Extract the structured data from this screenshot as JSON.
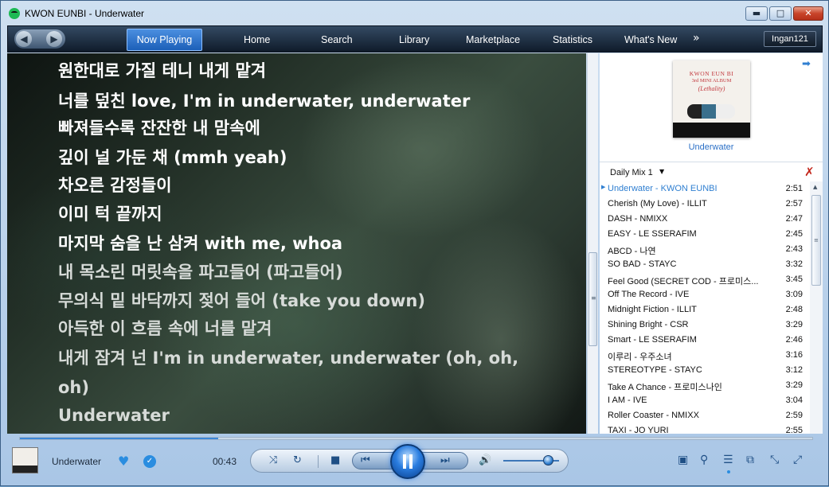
{
  "window": {
    "title": "KWON EUNBI - Underwater",
    "minimize_glyph": "▬",
    "maximize_glyph": "□",
    "close_glyph": "✕"
  },
  "nav": {
    "back_glyph": "◀",
    "forward_glyph": "▶",
    "tabs": [
      "Now Playing",
      "Home",
      "Search",
      "Library",
      "Marketplace",
      "Statistics",
      "What's New"
    ],
    "more_glyph": "»",
    "user": "Ingan121"
  },
  "lyrics": {
    "sung": [
      "원한대로 가질 테니 내게 맡겨",
      "너를 덮친 love, I'm in underwater, underwater",
      "빠져들수록 잔잔한 내 맘속에",
      "깊이 널 가둔 채 (mmh yeah)",
      "차오른 감정들이",
      "이미 턱 끝까지",
      "마지막 숨을 난 삼켜 with me, whoa"
    ],
    "upcoming": [
      "내 목소린 머릿속을 파고들어 (파고들어)",
      "무의식 밑 바닥까지 젖어 들어 (take you down)",
      "아득한 이 흐름 속에 너를 맡겨",
      "내게 잠겨 넌 I'm in underwater, underwater (oh, oh,",
      "oh)",
      "Underwater"
    ]
  },
  "now_playing": {
    "album_line1": "KWON EUN BI",
    "album_line2": "3rd MINI ALBUM",
    "album_line3": "(Lethality)",
    "title": "Underwater",
    "goto_glyph": "➡"
  },
  "playlist": {
    "name": "Daily Mix 1",
    "caret": "▼",
    "clear_glyph": "✗",
    "current_marker": "▶",
    "tracks": [
      {
        "title": "Underwater - KWON EUNBI",
        "duration": "2:51",
        "current": true
      },
      {
        "title": "Cherish (My Love) - ILLIT",
        "duration": "2:57"
      },
      {
        "title": "DASH - NMIXX",
        "duration": "2:47"
      },
      {
        "title": "EASY - LE SSERAFIM",
        "duration": "2:45"
      },
      {
        "title": "ABCD - 나연",
        "duration": "2:43"
      },
      {
        "title": "SO BAD - STAYC",
        "duration": "3:32"
      },
      {
        "title": "Feel Good (SECRET COD - 프로미스...",
        "duration": "3:45"
      },
      {
        "title": "Off The Record - IVE",
        "duration": "3:09"
      },
      {
        "title": "Midnight Fiction - ILLIT",
        "duration": "2:48"
      },
      {
        "title": "Shining Bright - CSR",
        "duration": "3:29"
      },
      {
        "title": "Smart - LE SSERAFIM",
        "duration": "2:46"
      },
      {
        "title": "이루리 - 우주소녀",
        "duration": "3:16"
      },
      {
        "title": "STEREOTYPE - STAYC",
        "duration": "3:12"
      },
      {
        "title": "Take A Chance - 프로미스나인",
        "duration": "3:29"
      },
      {
        "title": "I AM - IVE",
        "duration": "3:04"
      },
      {
        "title": "Roller Coaster - NMIXX",
        "duration": "2:59"
      },
      {
        "title": "TAXI - JO YURI",
        "duration": "2:55"
      }
    ]
  },
  "player": {
    "title": "Underwater",
    "elapsed": "00:43",
    "progress": 0.25,
    "volume": 0.8,
    "heart_glyph": "♥",
    "check_glyph": "✓",
    "shuffle_glyph": "⤨",
    "repeat_glyph": "↻",
    "stop_glyph": "■",
    "prev_glyph": "⏮",
    "next_glyph": "⏭",
    "volume_glyph": "🔊",
    "lyrics_glyph": "▣",
    "connect_glyph": "⚲",
    "queue_glyph": "☰",
    "devices_glyph": "⧉",
    "mini_glyph": "⤡",
    "full_glyph": "⤢"
  },
  "colors": {
    "accent": "#2a8de0",
    "current_track": "#2f7fd1",
    "close_button": "#c8442a"
  }
}
